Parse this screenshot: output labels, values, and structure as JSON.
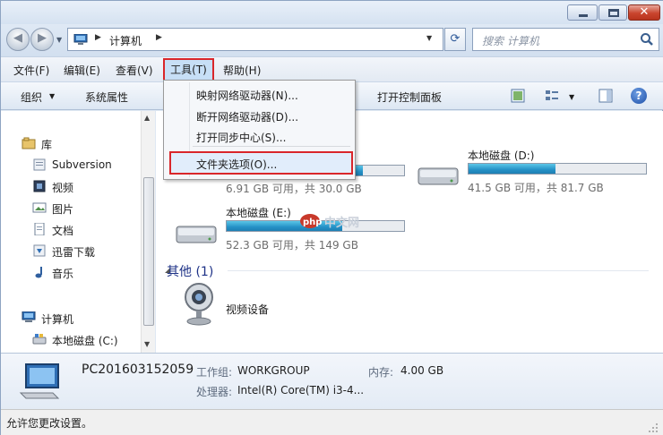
{
  "addressbar": {
    "location": "计算机"
  },
  "search": {
    "placeholder": "搜索 计算机"
  },
  "menubar": {
    "file": "文件(F)",
    "edit": "编辑(E)",
    "view": "查看(V)",
    "tools": "工具(T)",
    "help": "帮助(H)"
  },
  "toolbar": {
    "organize": "组织",
    "system_properties": "系统属性",
    "open_control_panel": "打开控制面板"
  },
  "tools_menu": {
    "items": [
      "映射网络驱动器(N)...",
      "断开网络驱动器(D)...",
      "打开同步中心(S)...",
      "文件夹选项(O)..."
    ],
    "highlighted": "文件夹选项(O)..."
  },
  "nav_pane": {
    "libraries": "库",
    "library_items": [
      "Subversion",
      "视频",
      "图片",
      "文档",
      "迅雷下载",
      "音乐"
    ],
    "computer": "计算机",
    "computer_items": [
      "本地磁盘 (C:)"
    ]
  },
  "drives": [
    {
      "label": "",
      "info": "6.91 GB 可用，共 30.0 GB",
      "used_fraction": 0.77
    },
    {
      "label": "本地磁盘 (D:)",
      "info": "41.5 GB 可用，共 81.7 GB",
      "used_fraction": 0.49
    },
    {
      "label": "本地磁盘 (E:)",
      "info": "52.3 GB 可用，共 149 GB",
      "used_fraction": 0.65
    }
  ],
  "other_group": {
    "header": "其他 (1)",
    "item": "视频设备"
  },
  "watermark": {
    "text": "中文网",
    "badge": "php"
  },
  "details": {
    "pc_name": "PC201603152059",
    "workgroup_label": "工作组:",
    "workgroup_value": "WORKGROUP",
    "memory_label": "内存:",
    "memory_value": "4.00 GB",
    "processor_label": "处理器:",
    "processor_value": "Intel(R) Core(TM) i3-4..."
  },
  "statusbar": {
    "text": "允许您更改设置。"
  },
  "colors": {
    "highlight_border": "#d9262a",
    "drive_bar": "#2591c6",
    "group_header": "#1e3287"
  }
}
